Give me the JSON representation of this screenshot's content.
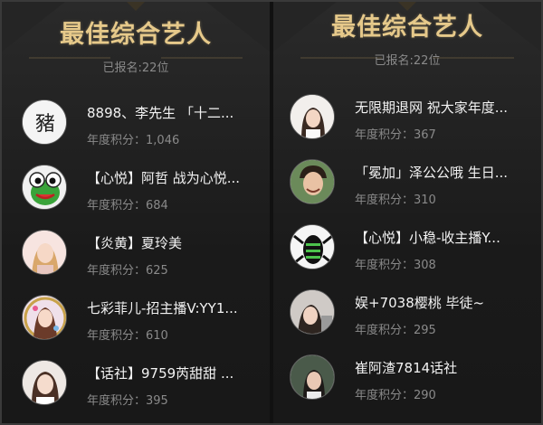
{
  "left": {
    "title": "最佳综合艺人",
    "signup": "已报名:22位",
    "entries": [
      {
        "name": "8898、李先生 「十二...",
        "score_label": "年度积分：",
        "score": "1,046",
        "avatar_char": "豬"
      },
      {
        "name": "【心悦】阿哲 战为心悦...",
        "score_label": "年度积分：",
        "score": "684"
      },
      {
        "name": "【炎黄】夏玲美",
        "score_label": "年度积分：",
        "score": "625"
      },
      {
        "name": "七彩菲儿-招主播V:YY1...",
        "score_label": "年度积分：",
        "score": "610"
      },
      {
        "name": "【话社】9759芮甜甜 ...",
        "score_label": "年度积分：",
        "score": "395"
      }
    ]
  },
  "right": {
    "title": "最佳综合艺人",
    "signup": "已报名:22位",
    "entries": [
      {
        "name": "无限期退网 祝大家年度...",
        "score_label": "年度积分：",
        "score": "367"
      },
      {
        "name": "「冕加」泽公公哦 生日...",
        "score_label": "年度积分：",
        "score": "310"
      },
      {
        "name": "【心悦】小稳-收主播Y...",
        "score_label": "年度积分：",
        "score": "308"
      },
      {
        "name": "娱+7038樱桃 毕徒~",
        "score_label": "年度积分：",
        "score": "295"
      },
      {
        "name": "崔阿渣7814话社",
        "score_label": "年度积分：",
        "score": "290"
      }
    ]
  },
  "colors": {
    "title_gold": "#e6c98a",
    "background": "#1b1b1b",
    "name_text": "#f2f2f2",
    "meta_text": "#8a8a8a"
  }
}
